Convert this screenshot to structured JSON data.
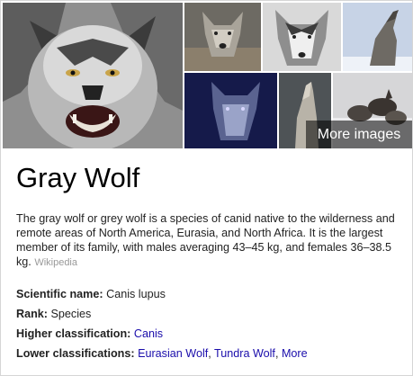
{
  "gallery": {
    "more_images_label": "More images"
  },
  "entity": {
    "title": "Gray Wolf",
    "description": "The gray wolf or grey wolf is a species of canid native to the wilderness and remote areas of North America, Eurasia, and North Africa. It is the largest member of its family, with males averaging 43–45 kg, and females 36–38.5 kg.",
    "source": "Wikipedia"
  },
  "facts": {
    "scientific_name": {
      "label": "Scientific name:",
      "value": "Canis lupus"
    },
    "rank": {
      "label": "Rank:",
      "value": "Species"
    },
    "higher_classification": {
      "label": "Higher classification:",
      "value": "Canis"
    },
    "lower_classifications": {
      "label": "Lower classifications:",
      "links": [
        "Eurasian Wolf",
        "Tundra Wolf",
        "More"
      ]
    }
  },
  "colors": {
    "link": "#1a0dab",
    "source": "#999999",
    "overlay": "rgba(0,0,0,0.55)"
  }
}
